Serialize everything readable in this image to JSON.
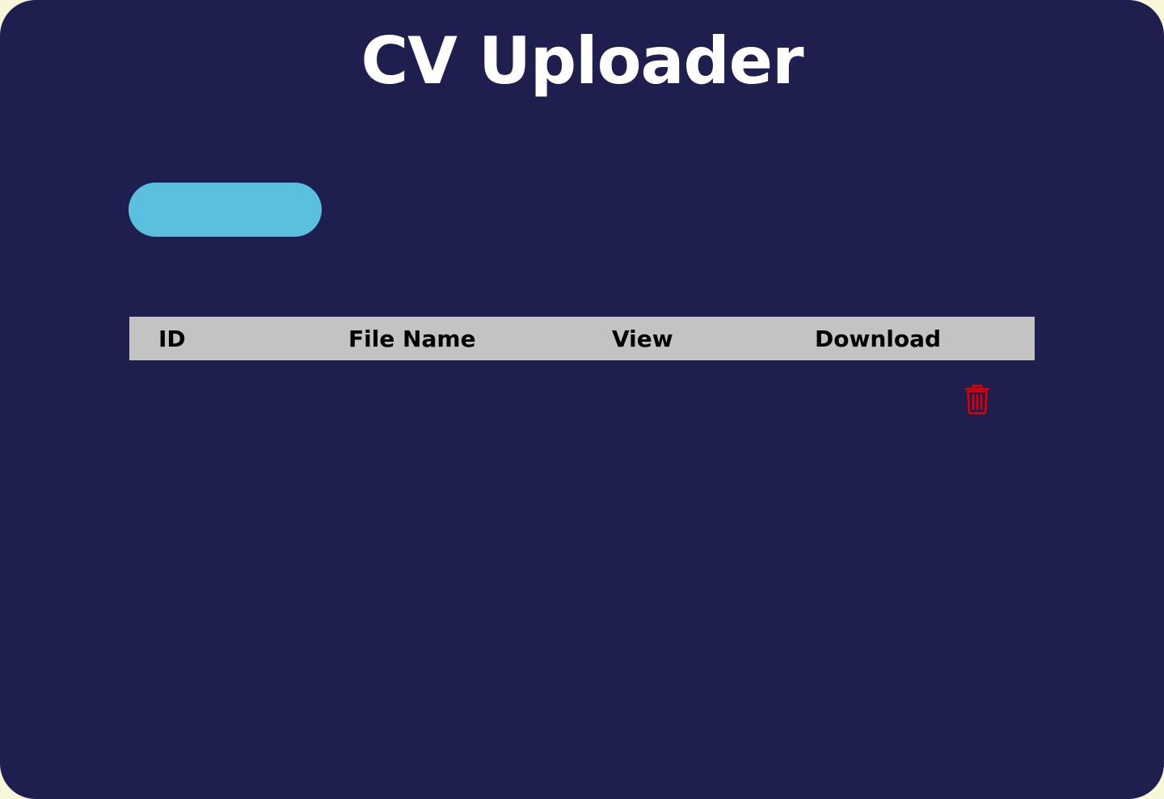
{
  "app": {
    "title": "CV Uploader"
  },
  "upload_button": {
    "label": "",
    "color": "#5bc0de"
  },
  "table": {
    "columns": [
      "ID",
      "File Name",
      "View",
      "Download"
    ],
    "rows": []
  },
  "delete": {
    "icon": "trash-icon",
    "color": "#e00000"
  },
  "colors": {
    "background": "#1e1e4f",
    "header": "#c3c3c3",
    "title": "#ffffff"
  }
}
